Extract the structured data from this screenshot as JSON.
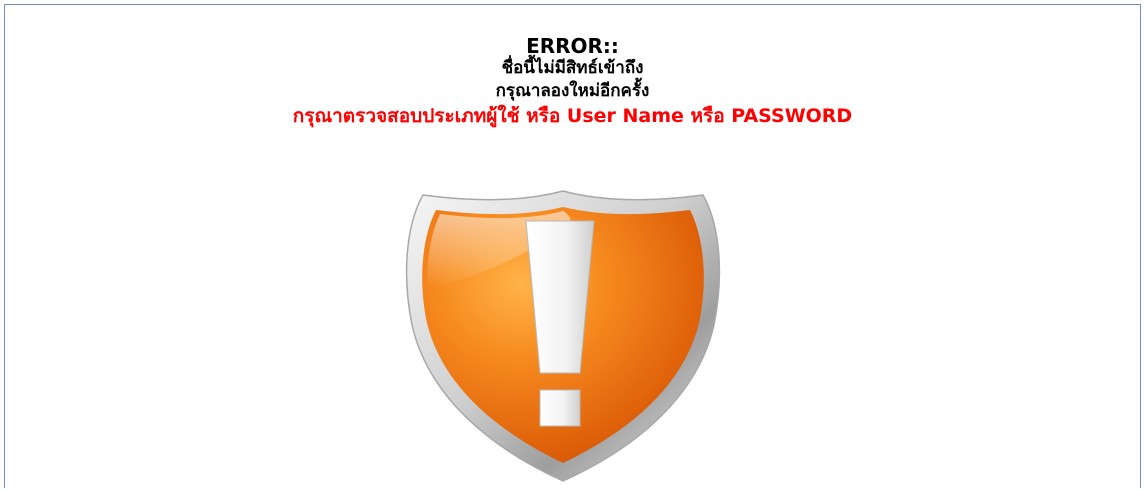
{
  "error": {
    "title": "ERROR::",
    "line1": "ชื่อนี้ไม่มีสิทธ์เข้าถึง",
    "line2": "กรุณาลองใหม่อีกครั้ง",
    "hint": "กรุณาตรวจสอบประเภทผู้ใช้ หรือ User Name หรือ PASSWORD"
  },
  "colors": {
    "title_text": "#000000",
    "hint_text": "#ff0000",
    "frame_border": "#6f8fb8",
    "shield_orange": "#f07a12",
    "shield_silver": "#d8d8d8"
  },
  "icons": {
    "shield": "warning-shield-icon"
  }
}
